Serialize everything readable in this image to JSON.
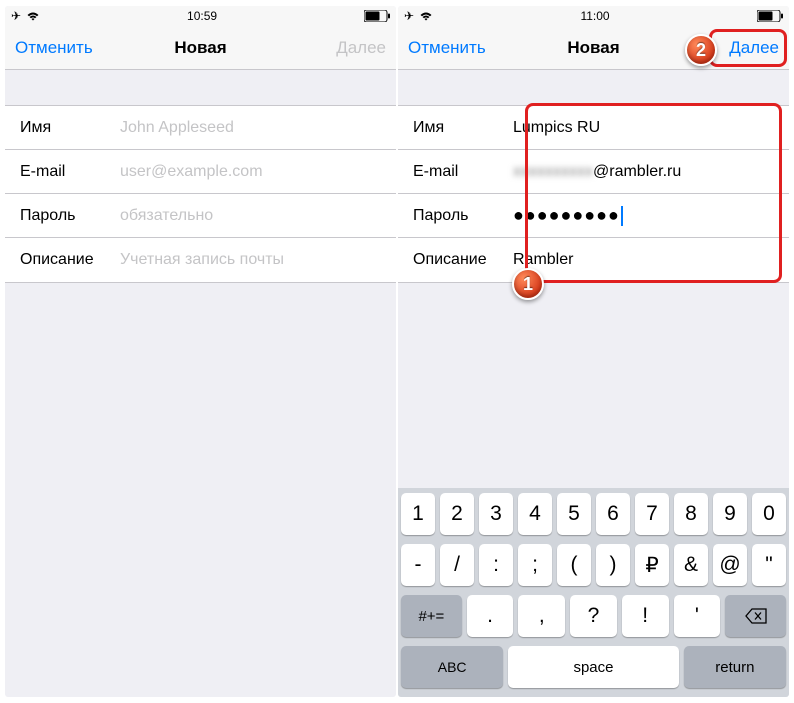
{
  "left": {
    "status": {
      "time": "10:59"
    },
    "nav": {
      "cancel": "Отменить",
      "title": "Новая",
      "next": "Далее"
    },
    "form": {
      "name": {
        "label": "Имя",
        "placeholder": "John Appleseed"
      },
      "email": {
        "label": "E-mail",
        "placeholder": "user@example.com"
      },
      "password": {
        "label": "Пароль",
        "placeholder": "обязательно"
      },
      "description": {
        "label": "Описание",
        "placeholder": "Учетная запись почты"
      }
    }
  },
  "right": {
    "status": {
      "time": "11:00"
    },
    "nav": {
      "cancel": "Отменить",
      "title": "Новая",
      "next": "Далее"
    },
    "form": {
      "name": {
        "label": "Имя",
        "value": "Lumpics RU"
      },
      "email": {
        "label": "E-mail",
        "value_blur": "xxxxxxxxxx",
        "value_suffix": "@rambler.ru"
      },
      "password": {
        "label": "Пароль",
        "value": "●●●●●●●●●"
      },
      "description": {
        "label": "Описание",
        "value": "Rambler"
      }
    },
    "keyboard": {
      "row1": [
        "1",
        "2",
        "3",
        "4",
        "5",
        "6",
        "7",
        "8",
        "9",
        "0"
      ],
      "row2": [
        "-",
        "/",
        ":",
        ";",
        "(",
        ")",
        "₽",
        "&",
        "@",
        "\""
      ],
      "row3": [
        ".",
        ",",
        "?",
        "!",
        "'"
      ],
      "shift": "#+=",
      "abc": "ABC",
      "space": "space",
      "return": "return"
    },
    "callouts": {
      "one": "1",
      "two": "2"
    }
  }
}
